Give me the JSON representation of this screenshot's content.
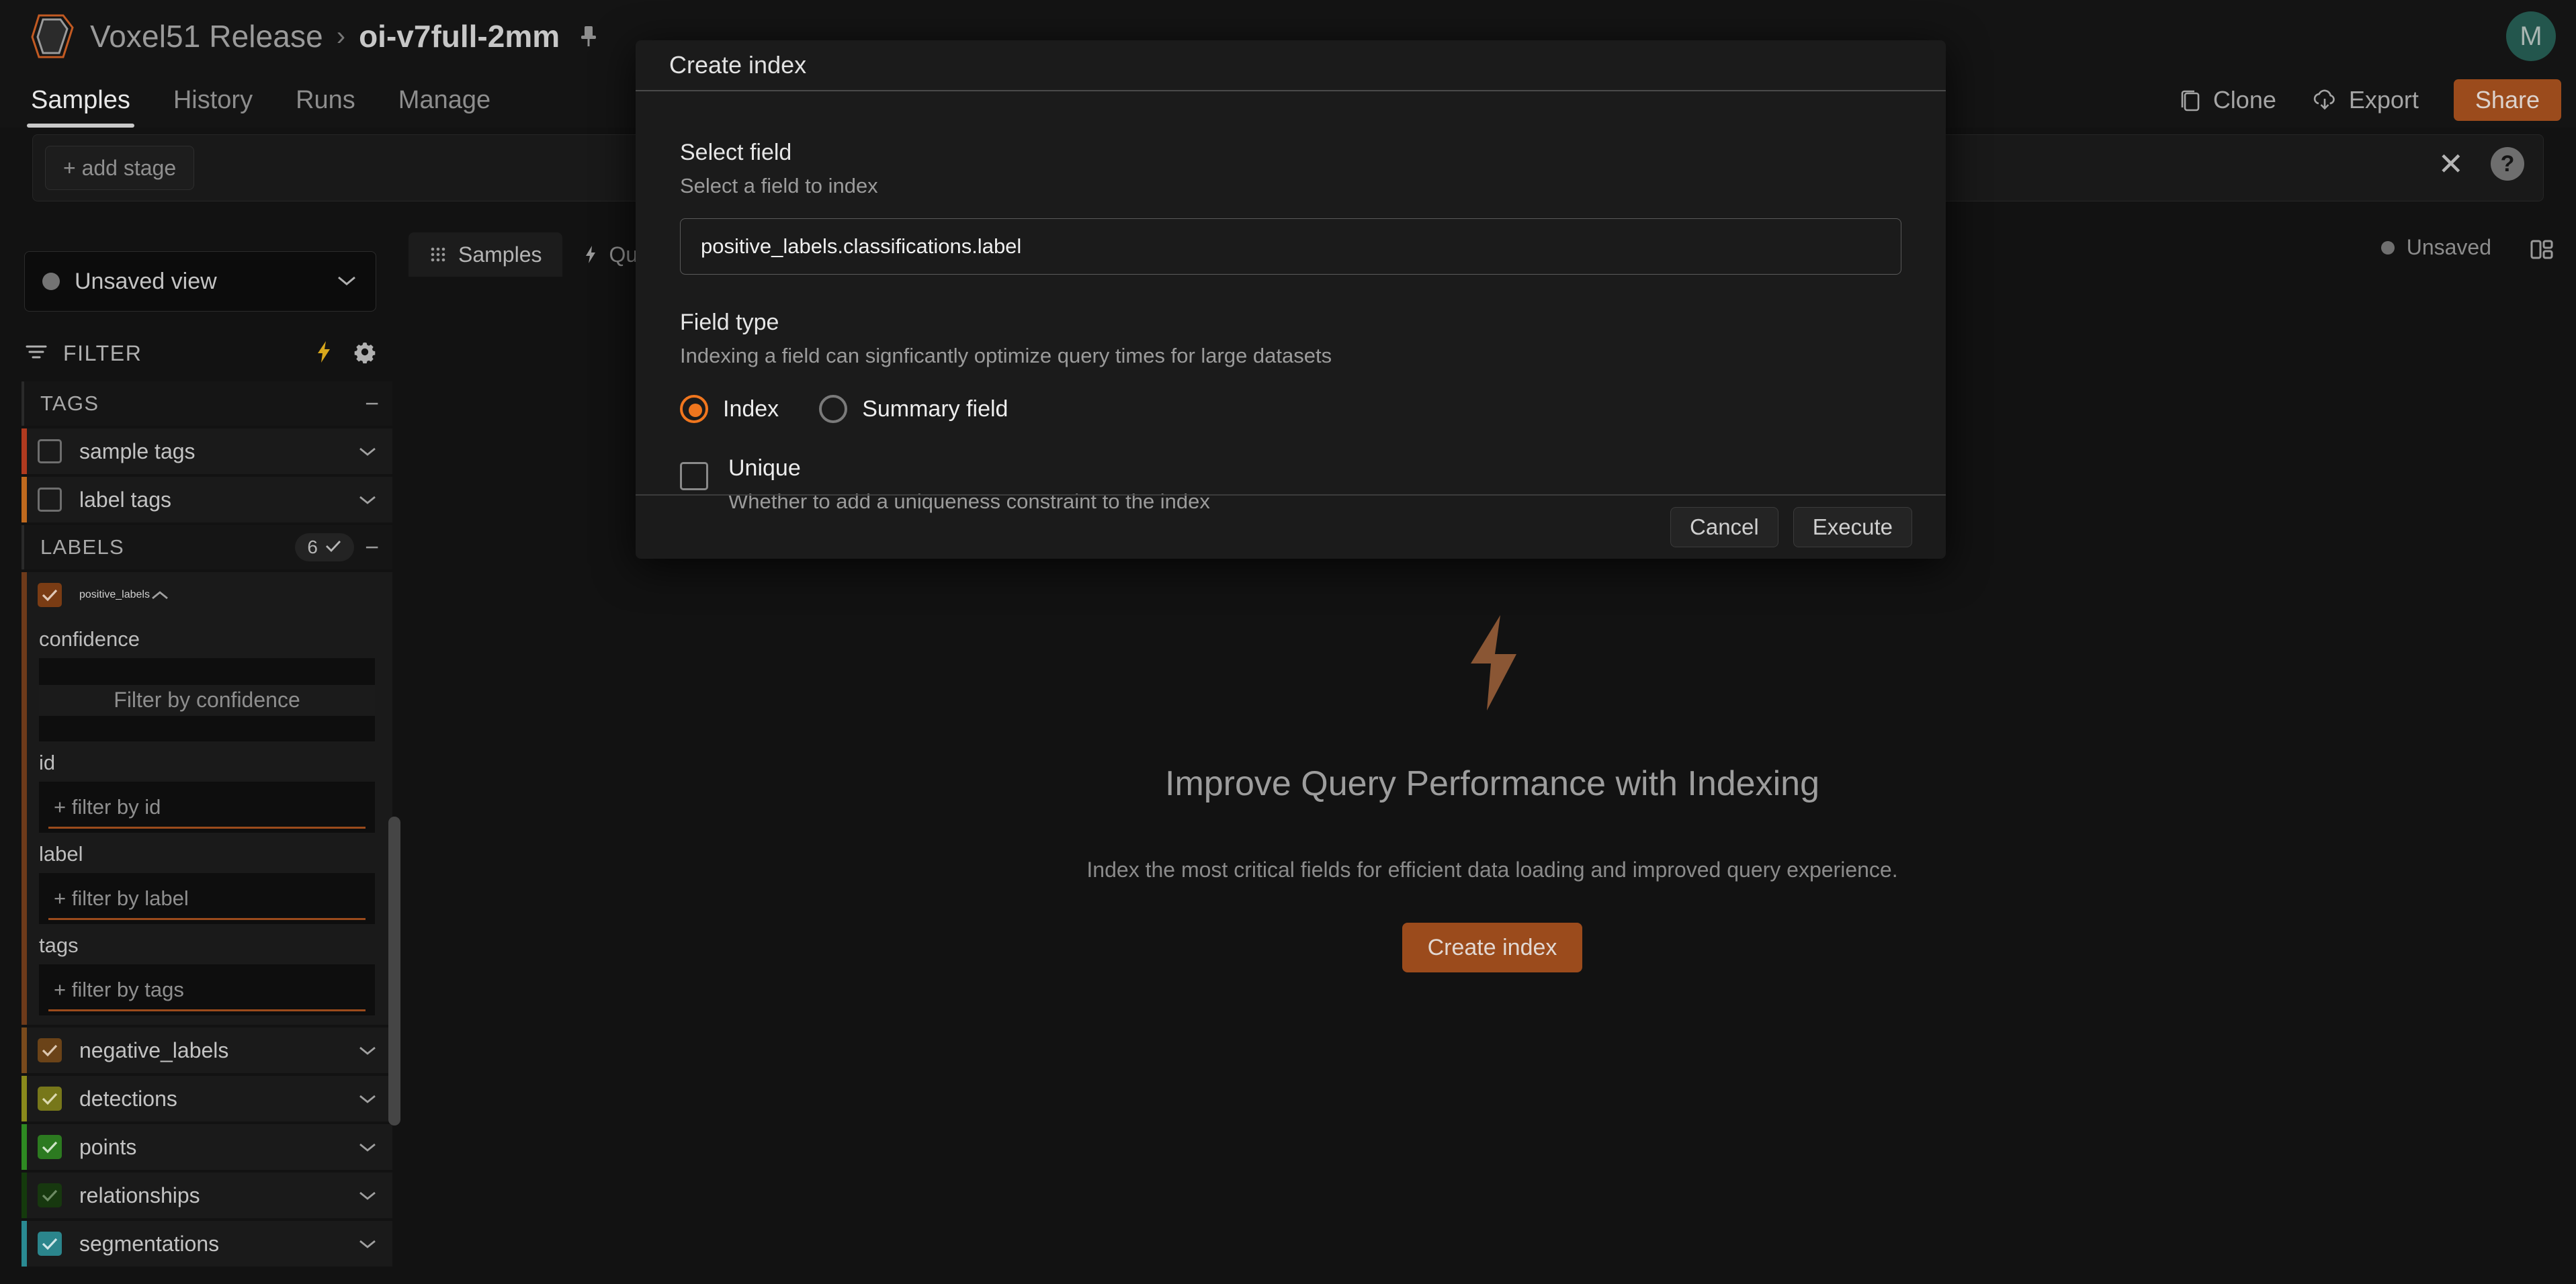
{
  "header": {
    "logo_icon": "voxel51-logo-icon",
    "org": "Voxel51 Release",
    "separator": "›",
    "dataset": "oi-v7full-2mm",
    "pin_icon": "pin-icon",
    "avatar_initial": "M",
    "avatar_color": "#23564d"
  },
  "nav_tabs": [
    {
      "label": "Samples",
      "active": true
    },
    {
      "label": "History",
      "active": false
    },
    {
      "label": "Runs",
      "active": false
    },
    {
      "label": "Manage",
      "active": false
    }
  ],
  "top_actions": {
    "clone": {
      "label": "Clone",
      "icon": "copy-icon"
    },
    "export": {
      "label": "Export",
      "icon": "cloud-download-icon"
    },
    "share": {
      "label": "Share",
      "color": "#9b4b1c"
    }
  },
  "view_bar": {
    "add_stage_label": "+ add stage",
    "close_icon": "close-icon",
    "help_icon": "help-icon",
    "collapse_icon": "chevron-up-icon"
  },
  "panel_tabs": [
    {
      "label": "Samples",
      "icon": "grid-icon",
      "active": true
    },
    {
      "label": "Que",
      "icon": "lightning-icon",
      "active": false
    }
  ],
  "panel_status": {
    "label": "Unsaved",
    "layout_icon": "panel-layout-icon"
  },
  "sidebar": {
    "view_selector": {
      "label": "Unsaved view",
      "dropdown_icon": "chevron-down-icon"
    },
    "filter_header": {
      "label": "FILTER",
      "filter_icon": "filter-icon",
      "lightning_icon": "lightning-icon",
      "settings_icon": "gear-icon"
    },
    "groups": [
      {
        "title": "TAGS",
        "collapse_icon": "minus-icon",
        "count": null,
        "rows": [
          {
            "label": "sample tags",
            "checked": false,
            "accent": "#b03a1f",
            "chevron": "chevron-down-icon"
          },
          {
            "label": "label tags",
            "checked": false,
            "accent": "#c06a1e",
            "chevron": "chevron-down-icon"
          }
        ]
      },
      {
        "title": "LABELS",
        "collapse_icon": "minus-icon",
        "count": "6",
        "count_icon": "check-icon",
        "rows": []
      }
    ],
    "expanded_field": {
      "label": "positive_labels",
      "checked": true,
      "accent": "#6e3a1a",
      "checkbox_color": "#7a3c14",
      "chevron": "chevron-up-icon",
      "subfields": [
        {
          "name": "confidence",
          "type": "slider",
          "placeholder": "Filter by confidence"
        },
        {
          "name": "id",
          "type": "text",
          "placeholder": "+ filter by id"
        },
        {
          "name": "label",
          "type": "text",
          "placeholder": "+ filter by label"
        },
        {
          "name": "tags",
          "type": "text",
          "placeholder": "+ filter by tags"
        }
      ]
    },
    "label_rows": [
      {
        "label": "negative_labels",
        "checked": true,
        "accent": "#7a4a1c",
        "checkbox_color": "#6b4318",
        "chevron": "chevron-down-icon"
      },
      {
        "label": "detections",
        "checked": true,
        "accent": "#8a8a1c",
        "checkbox_color": "#77771a",
        "chevron": "chevron-down-icon"
      },
      {
        "label": "points",
        "checked": true,
        "accent": "#2e8a22",
        "checkbox_color": "#2c7a20",
        "chevron": "chevron-down-icon"
      },
      {
        "label": "relationships",
        "checked": true,
        "accent": "#143a0c",
        "checkbox_color": "#17380f",
        "chevron": "chevron-down-icon"
      },
      {
        "label": "segmentations",
        "checked": true,
        "accent": "#2a8a92",
        "checkbox_color": "#2b858c",
        "chevron": "chevron-down-icon"
      }
    ]
  },
  "main": {
    "empty_state": {
      "icon": "lightning-bolt-icon",
      "icon_color": "#8a5634",
      "title": "Improve Query Performance with Indexing",
      "subtitle": "Index the most critical fields for efficient data loading and improved query experience.",
      "button_label": "Create index",
      "button_color": "#9b4b1c"
    }
  },
  "modal": {
    "title": "Create index",
    "select_field": {
      "label": "Select field",
      "description": "Select a field to index",
      "value": "positive_labels.classifications.label"
    },
    "field_type": {
      "label": "Field type",
      "description": "Indexing a field can signficantly optimize query times for large datasets",
      "options": [
        {
          "label": "Index",
          "selected": true
        },
        {
          "label": "Summary field",
          "selected": false
        }
      ],
      "accent_color": "#f0761e"
    },
    "unique": {
      "label": "Unique",
      "description": "Whether to add a uniqueness constraint to the index",
      "checked": false
    },
    "footer": {
      "cancel_label": "Cancel",
      "execute_label": "Execute"
    }
  }
}
